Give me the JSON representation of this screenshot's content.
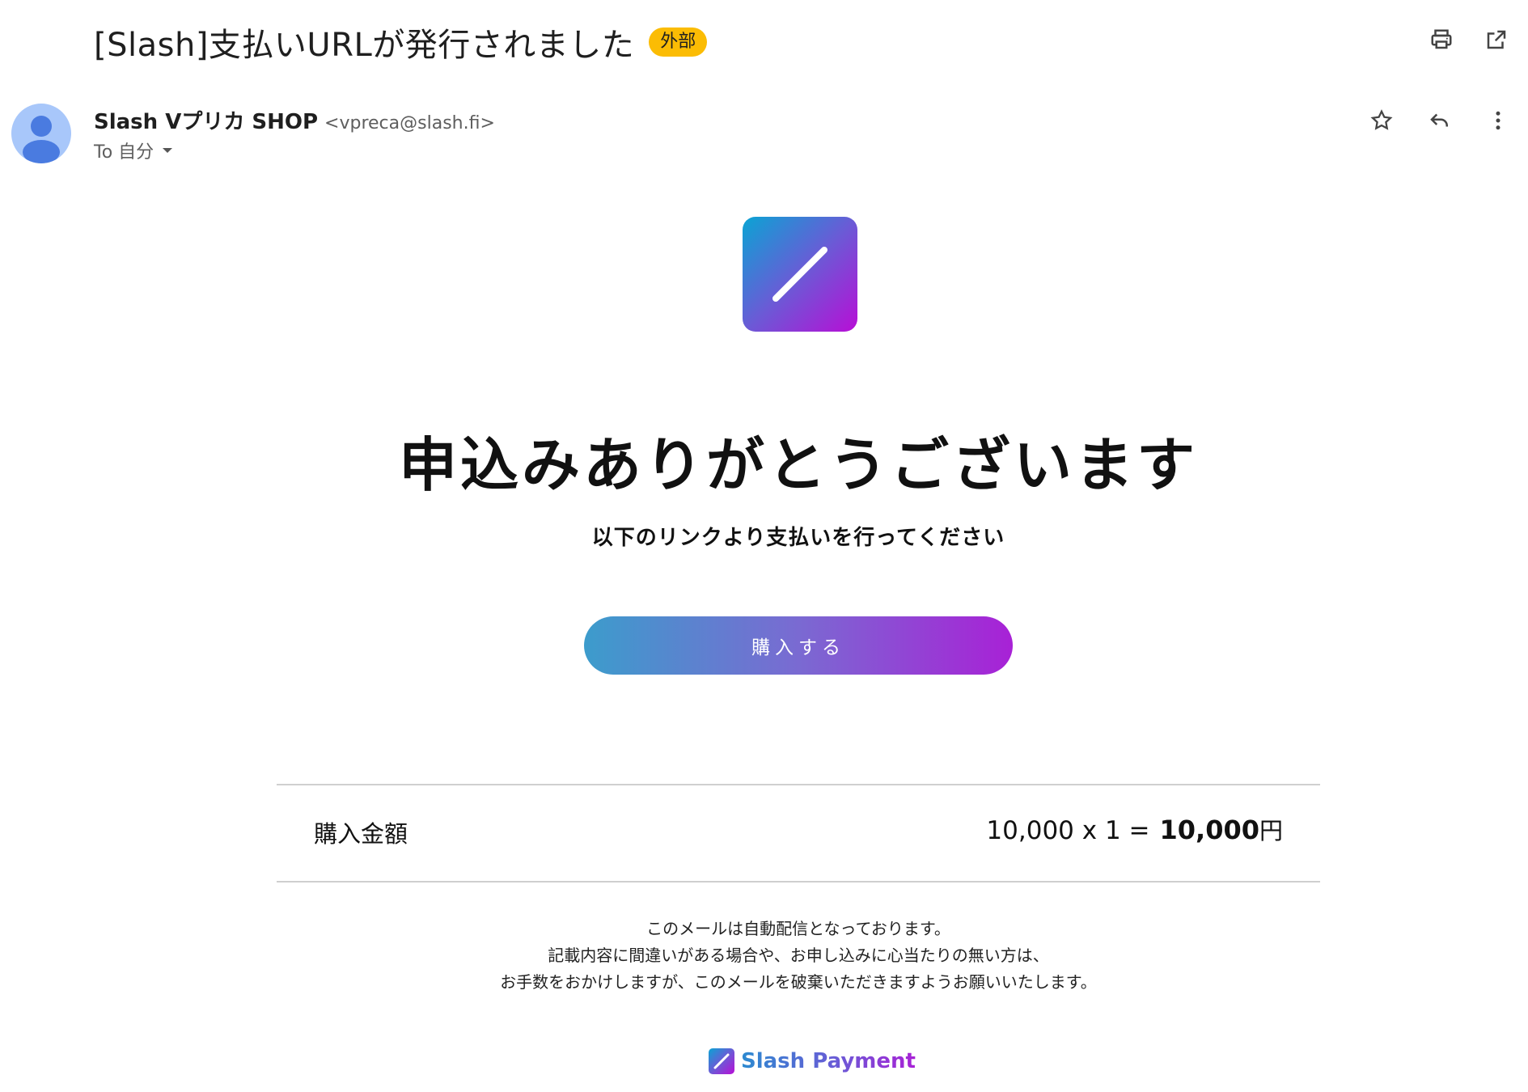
{
  "email": {
    "subject": "[Slash]支払いURLが発行されました",
    "external_badge": "外部",
    "sender_name": "Slash Vプリカ SHOP",
    "sender_email": "<vpreca@slash.fi>",
    "to_label": "To 自分"
  },
  "toolbar_icons": [
    "print-icon",
    "open-in-new-window-icon"
  ],
  "message_actions": [
    "star-icon",
    "reply-icon",
    "more-vert-icon"
  ],
  "body": {
    "headline": "申込みありがとうございます",
    "subline": "以下のリンクより支払いを行ってください",
    "buy_button": "購入する",
    "amount_label": "購入金額",
    "amount_formula": "10,000 x 1 =",
    "amount_total": "10,000",
    "amount_currency": "円",
    "notice_lines": [
      "このメールは自動配信となっております。",
      "記載内容に間違いがある場合や、お申し込みに心当たりの無い方は、",
      "お手数をおかけしますが、このメールを破棄いただきますようお願いいたします。"
    ],
    "brand": "Slash Payment"
  },
  "colors": {
    "badge": "#fbbc04",
    "gradient_start": "#0aa4d4",
    "gradient_mid": "#6a5bd6",
    "gradient_end": "#b80ed6",
    "avatar": "#a8c7fa"
  }
}
